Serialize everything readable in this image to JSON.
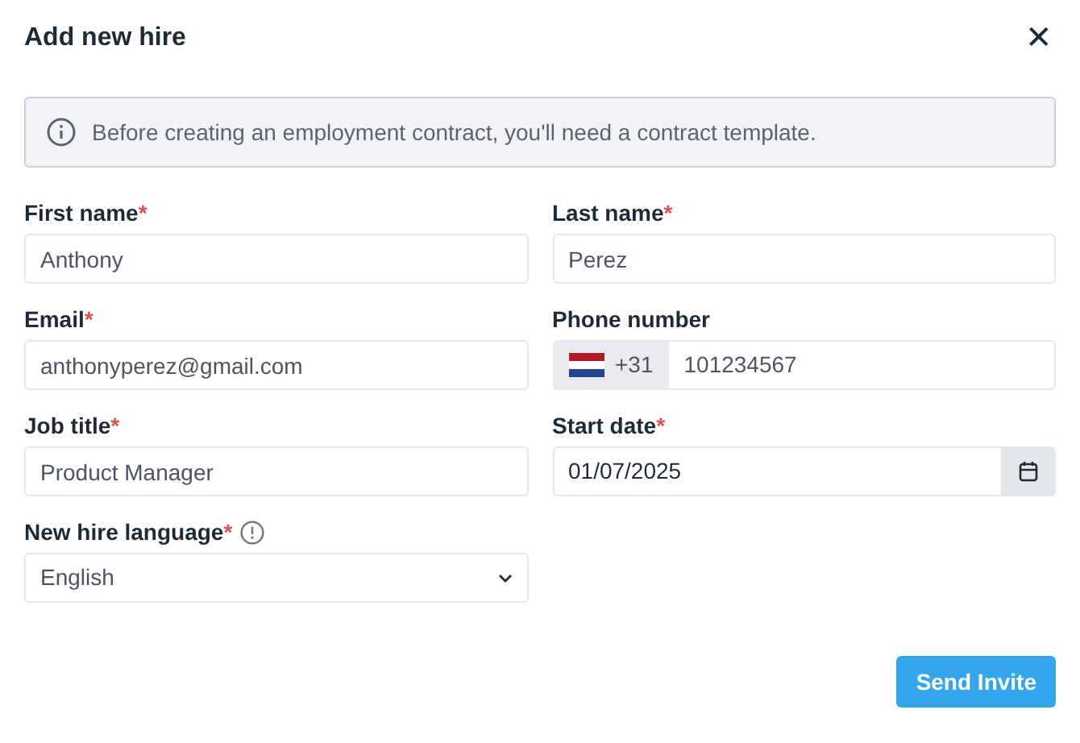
{
  "dialog": {
    "title": "Add new hire",
    "close": "✕"
  },
  "alert": {
    "text": "Before creating an employment contract, you'll need a contract template."
  },
  "fields": [
    {
      "kind": "text",
      "label": "First name",
      "required_mark": "*",
      "value": "Anthony"
    },
    {
      "kind": "text",
      "label": "Last name",
      "required_mark": "*",
      "value": "Perez"
    },
    {
      "kind": "text",
      "label": "Email",
      "required_mark": "*",
      "value": "anthonyperez@gmail.com"
    },
    {
      "kind": "phone",
      "label": "Phone number",
      "prefix": "+31",
      "value": "101234567"
    },
    {
      "kind": "text",
      "label": "Job title",
      "required_mark": "*",
      "value": "Product Manager"
    },
    {
      "kind": "date",
      "label": "Start date",
      "required_mark": "*",
      "value": "01/07/2025"
    },
    {
      "kind": "select",
      "label": "New hire language",
      "required_mark": "*",
      "info": true,
      "value": "English"
    }
  ],
  "buttons": [
    {
      "label": "Send Invite"
    }
  ]
}
